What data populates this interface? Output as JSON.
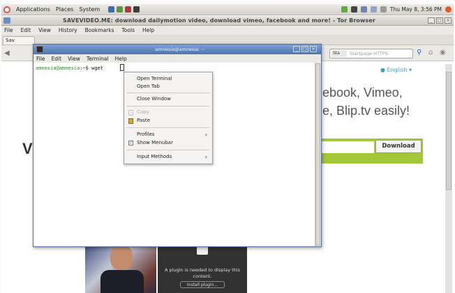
{
  "top_panel": {
    "menus": [
      "Applications",
      "Places",
      "System"
    ],
    "clock": "Thu May 8, 3:56 PM"
  },
  "browser": {
    "title": "SAVEVIDEO.ME: download dailymotion video, download vimeo, facebook and more! - Tor Browser",
    "menubar": [
      "File",
      "Edit",
      "View",
      "History",
      "Bookmarks",
      "Tools",
      "Help"
    ],
    "tab_label": "Sav",
    "search_engine": "Sta",
    "search_placeholder": "Startpage HTTPS",
    "win_buttons": [
      "_",
      "□",
      "×"
    ]
  },
  "page": {
    "english_link": "● English ▾",
    "headline_line1": "ebook, Vimeo,",
    "headline_line2": "e, Blip.tv easily!",
    "v_logo": "V",
    "download_button": "Download",
    "plugin_message": "A plugin is needed to display this content.",
    "install_plugin": "Install plugin...",
    "plugin_close": "×"
  },
  "terminal": {
    "title": "amnesia@amnesia: ~",
    "win_buttons": [
      "_",
      "□",
      "×"
    ],
    "menubar": [
      "File",
      "Edit",
      "View",
      "Terminal",
      "Help"
    ],
    "prompt_user": "amnesia@amnesia",
    "prompt_rest": ":~$ wget "
  },
  "context_menu": {
    "open_terminal": "Open Terminal",
    "open_tab": "Open Tab",
    "close_window": "Close Window",
    "copy": "Copy",
    "paste": "Paste",
    "profiles": "Profiles",
    "show_menubar": "Show Menubar",
    "input_methods": "Input Methods",
    "submenu_arrow": "›"
  },
  "colors": {
    "accent_green": "#a2c739",
    "terminal_title": "#4c74b0",
    "link_blue": "#3aa0c9"
  }
}
